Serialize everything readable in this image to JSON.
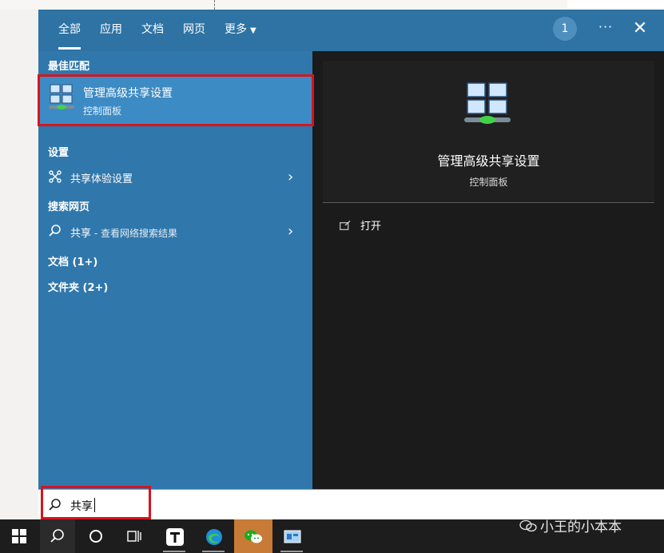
{
  "tabs": [
    {
      "label": "全部",
      "active": true
    },
    {
      "label": "应用"
    },
    {
      "label": "文档"
    },
    {
      "label": "网页"
    },
    {
      "label": "更多"
    }
  ],
  "header": {
    "badge": "1",
    "more_dots": "···",
    "close_glyph": "✕"
  },
  "results": {
    "best_match_header": "最佳匹配",
    "best_match": {
      "title": "管理高级共享设置",
      "subtitle": "控制面板"
    },
    "settings_header": "设置",
    "settings_item": "共享体验设置",
    "web_header": "搜索网页",
    "web_item_query": "共享",
    "web_item_suffix": " - 查看网络搜索结果",
    "documents": "文档 (1+)",
    "folders": "文件夹 (2+)"
  },
  "preview": {
    "title": "管理高级共享设置",
    "subtitle": "控制面板",
    "action_open": "打开"
  },
  "search": {
    "value": "共享"
  },
  "taskbar": {
    "watermark": "小王的小本本"
  },
  "colors": {
    "accent": "#3077ab",
    "highlight": "#3d8bc4",
    "preview_bg": "#1b1b1b",
    "annotation_red": "#d8141c"
  }
}
